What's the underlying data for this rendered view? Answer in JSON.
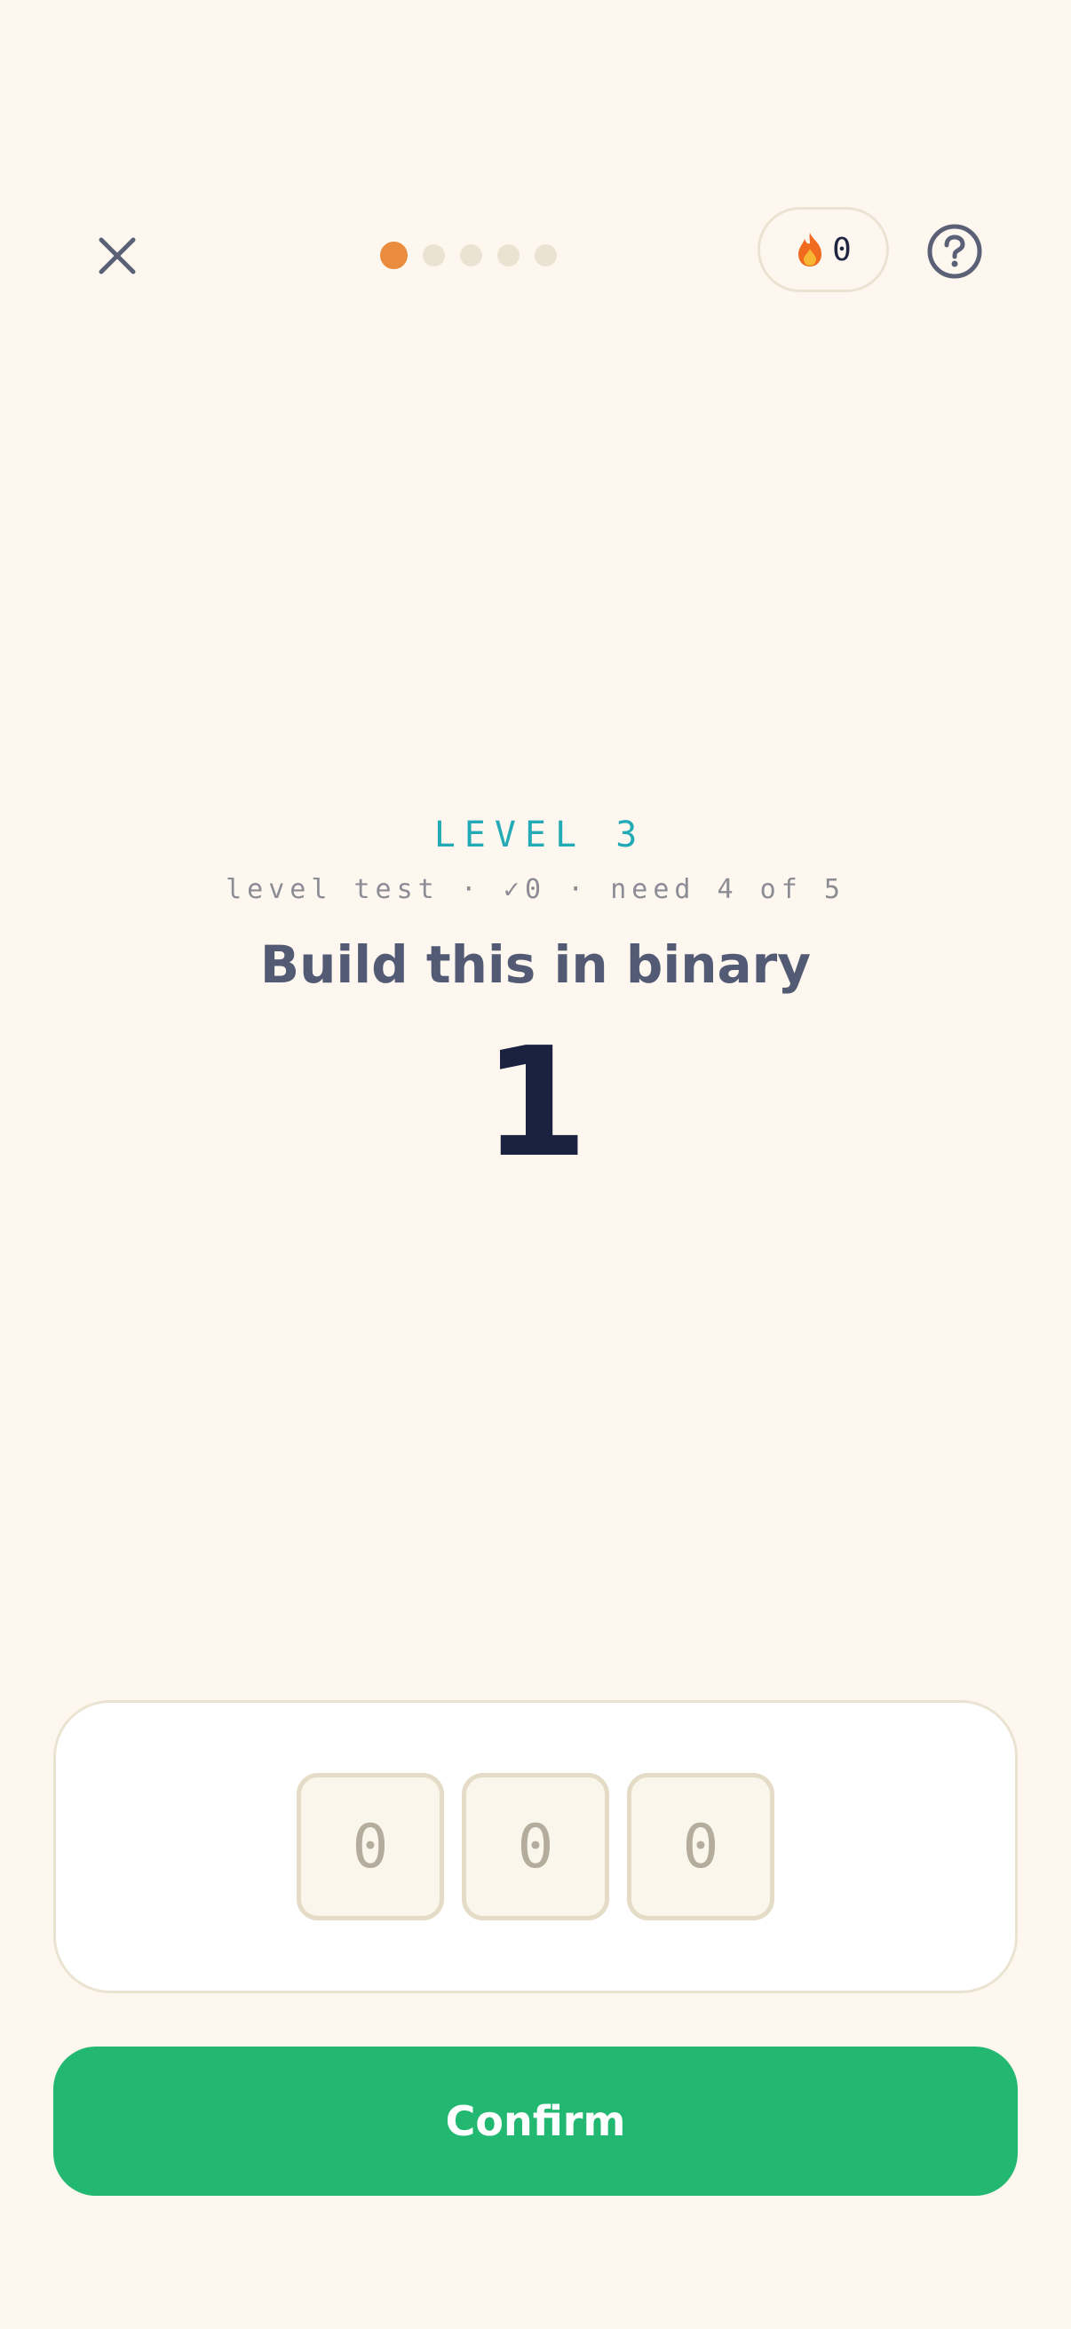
{
  "header": {
    "close_icon": "close-icon",
    "progress": {
      "total": 5,
      "current": 1
    },
    "streak": {
      "icon": "fire-icon",
      "count": "0"
    },
    "help_icon": "help-circle-icon"
  },
  "prompt": {
    "level_label": "LEVEL 3",
    "meta": "level test · ✓0 · need 4 of 5",
    "title": "Build this in binary",
    "target": "1"
  },
  "bits": [
    "0",
    "0",
    "0"
  ],
  "confirm_label": "Confirm",
  "colors": {
    "background": "#fdf7ef",
    "accent_orange": "#ea8c3d",
    "level_teal": "#23aab7",
    "confirm_green": "#22b872"
  }
}
